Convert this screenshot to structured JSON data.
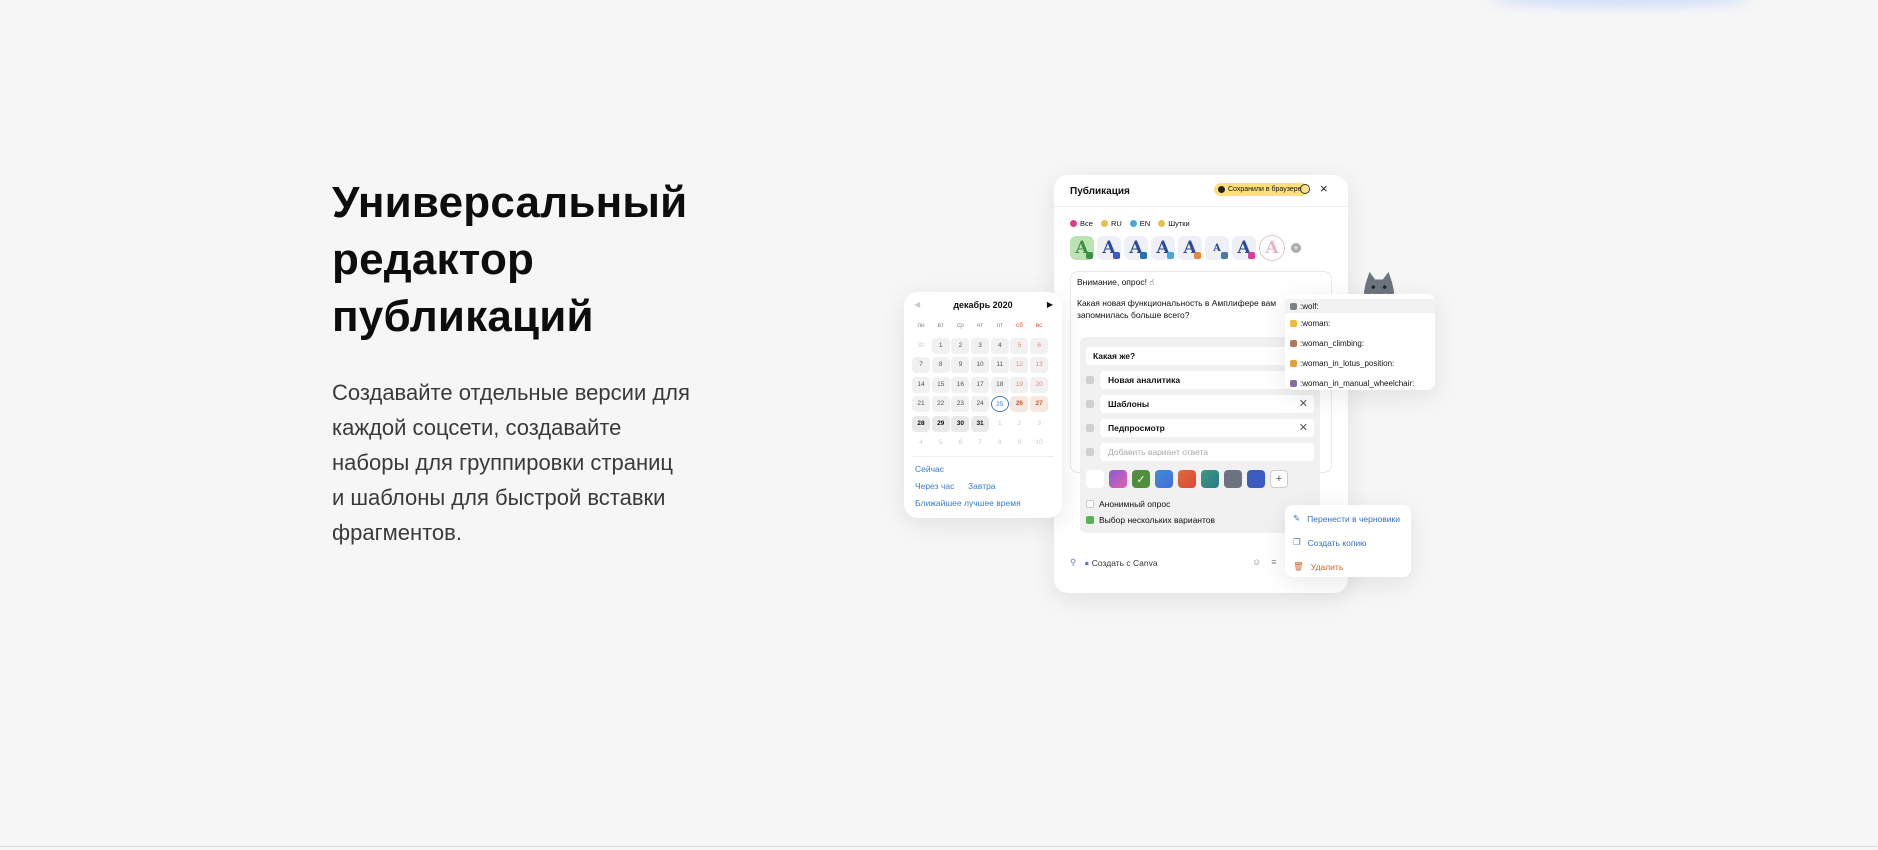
{
  "hero": {
    "title_lines": [
      "Универсальный",
      "редактор",
      "публикаций"
    ],
    "description_lines": [
      "Создавайте отдельные версии для",
      "каждой соцсети, создавайте",
      "наборы для группировки страниц",
      "и шаблоны для быстрой вставки",
      "фрагментов."
    ]
  },
  "editor": {
    "title": "Публикация",
    "save_badge": "Сохранили в браузере",
    "close_icon": "×",
    "tags": [
      {
        "label": "Все",
        "color": "#e0398a"
      },
      {
        "label": "RU",
        "color": "#e6c14a"
      },
      {
        "label": "EN",
        "color": "#4aa8d8"
      },
      {
        "label": "Шутки",
        "color": "#e6c14a"
      }
    ],
    "account_icon_letter": "A",
    "message_line1": "Внимание, опрос! ☝",
    "message_line2": "Какая новая функциональность в Амплифере вам запомнилась больше всего?",
    "poll_question": "Какая же?",
    "options": [
      "Новая аналитика",
      "Шаблоны",
      "Педпросмотр"
    ],
    "option_placeholder": "Добавить вариант ответа",
    "colors": [
      "#ffffff",
      "#c264c9",
      "#4f8f3d",
      "#3a8fd8",
      "#e06a3a",
      "#3e9a7a",
      "#6b7280",
      "#3b5bc0"
    ],
    "anonymous_label": "Анонимный опрос",
    "multiple_label": "Выбор нескольких вариантов",
    "canva_label": "Создать с Canva"
  },
  "calendar": {
    "month": "декабрь 2020",
    "prev": "◀",
    "next": "▶",
    "weekdays": [
      "пн",
      "вт",
      "ср",
      "чт",
      "пт",
      "сб",
      "вс"
    ],
    "days": [
      {
        "n": "30",
        "t": "o"
      },
      {
        "n": "1",
        "t": "d"
      },
      {
        "n": "2",
        "t": "d"
      },
      {
        "n": "3",
        "t": "d"
      },
      {
        "n": "4",
        "t": "d"
      },
      {
        "n": "5",
        "t": "we"
      },
      {
        "n": "6",
        "t": "we"
      },
      {
        "n": "7",
        "t": "d"
      },
      {
        "n": "8",
        "t": "d"
      },
      {
        "n": "9",
        "t": "d"
      },
      {
        "n": "10",
        "t": "d"
      },
      {
        "n": "11",
        "t": "d"
      },
      {
        "n": "12",
        "t": "we"
      },
      {
        "n": "13",
        "t": "we"
      },
      {
        "n": "14",
        "t": "d"
      },
      {
        "n": "15",
        "t": "d"
      },
      {
        "n": "16",
        "t": "d"
      },
      {
        "n": "17",
        "t": "d"
      },
      {
        "n": "18",
        "t": "d"
      },
      {
        "n": "19",
        "t": "we"
      },
      {
        "n": "20",
        "t": "we"
      },
      {
        "n": "21",
        "t": "d"
      },
      {
        "n": "22",
        "t": "d"
      },
      {
        "n": "23",
        "t": "d"
      },
      {
        "n": "24",
        "t": "d"
      },
      {
        "n": "25",
        "t": "today"
      },
      {
        "n": "26",
        "t": "bw"
      },
      {
        "n": "27",
        "t": "bw"
      },
      {
        "n": "28",
        "t": "b"
      },
      {
        "n": "29",
        "t": "b"
      },
      {
        "n": "30",
        "t": "b"
      },
      {
        "n": "31",
        "t": "b"
      },
      {
        "n": "1",
        "t": "o"
      },
      {
        "n": "2",
        "t": "o"
      },
      {
        "n": "3",
        "t": "o"
      },
      {
        "n": "4",
        "t": "o"
      },
      {
        "n": "5",
        "t": "o"
      },
      {
        "n": "6",
        "t": "o"
      },
      {
        "n": "7",
        "t": "o"
      },
      {
        "n": "8",
        "t": "o"
      },
      {
        "n": "9",
        "t": "o"
      },
      {
        "n": "10",
        "t": "o"
      }
    ],
    "quick": [
      "Сейчас",
      "Через час",
      "Завтра",
      "Ближайшее лучшее время"
    ]
  },
  "emoji_list": [
    ":wolf:",
    ":woman:",
    ":woman_climbing:",
    ":woman_in_lotus_position:",
    ":woman_in_manual_wheelchair:"
  ],
  "context_menu": [
    "Перенести в черновики",
    "Создать копию",
    "Удалить"
  ]
}
